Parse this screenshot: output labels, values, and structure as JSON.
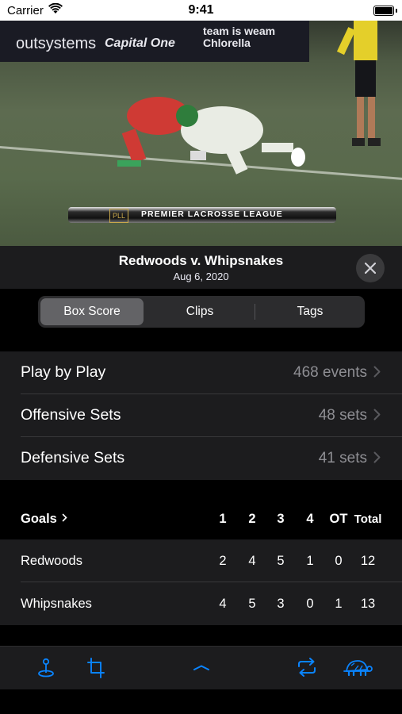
{
  "status_bar": {
    "carrier": "Carrier",
    "time": "9:41"
  },
  "video": {
    "sponsor_1": "outsystems",
    "sponsor_2": "Capital One",
    "sponsor_3": "team is weam Chlorella",
    "lower_third_logo": "PLL",
    "lower_third": "PREMIER LACROSSE LEAGUE"
  },
  "header": {
    "title": "Redwoods v. Whipsnakes",
    "date": "Aug 6, 2020"
  },
  "tabs": [
    {
      "label": "Box Score",
      "selected": true
    },
    {
      "label": "Clips",
      "selected": false
    },
    {
      "label": "Tags",
      "selected": false
    }
  ],
  "stats_list": [
    {
      "label": "Play by Play",
      "value": "468 events"
    },
    {
      "label": "Offensive Sets",
      "value": "48 sets"
    },
    {
      "label": "Defensive Sets",
      "value": "41 sets"
    }
  ],
  "box_score": {
    "title": "Goals",
    "columns": [
      "1",
      "2",
      "3",
      "4",
      "OT",
      "Total"
    ],
    "rows": [
      {
        "team": "Redwoods",
        "scores": [
          "2",
          "4",
          "5",
          "1",
          "0",
          "12"
        ]
      },
      {
        "team": "Whipsnakes",
        "scores": [
          "4",
          "5",
          "3",
          "0",
          "1",
          "13"
        ]
      }
    ]
  },
  "toolbar": {
    "icons": [
      "location-pin-icon",
      "crop-icon",
      "chevron-up-icon",
      "repeat-icon",
      "turtle-icon"
    ],
    "accent_color": "#0a84ff"
  },
  "colors": {
    "background": "#000000",
    "surface": "#1c1c1e",
    "secondary_text": "#8e8e93"
  }
}
